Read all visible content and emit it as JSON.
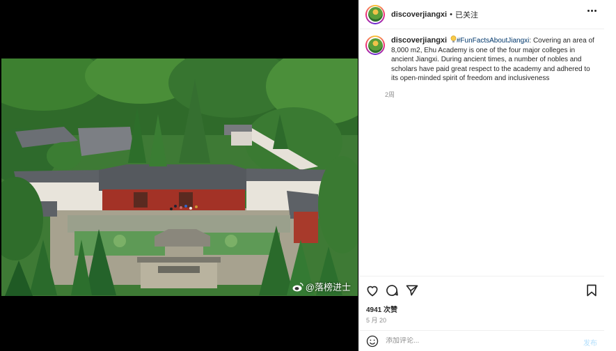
{
  "account": {
    "username": "discoverjiangxi",
    "separator": "•",
    "follow_status": "已关注"
  },
  "caption": {
    "username": "discoverjiangxi",
    "hashtag": "#FunFactsAboutJiangxi",
    "text": ": Covering an area of 8,000 m2, Ehu Academy is one of the four major colleges in ancient Jiangxi. During ancient times, a number of nobles and scholars have paid great respect to the academy and adhered to its open-minded spirit of freedom and inclusiveness",
    "time": "2周"
  },
  "media": {
    "watermark": "@落榜进士"
  },
  "stats": {
    "likes": "4941 次赞",
    "date": "5 月 20"
  },
  "comment": {
    "placeholder": "添加评论...",
    "post_label": "发布"
  },
  "icons": {
    "more": "more-horizontal-icon",
    "heart": "heart-icon",
    "comment": "comment-icon",
    "share": "share-icon",
    "save": "bookmark-icon",
    "emoji": "smile-icon",
    "bulb": "lightbulb-icon"
  },
  "colors": {
    "link": "#00376b",
    "post_disabled": "#b2dffc",
    "muted": "#8e8e8e"
  }
}
